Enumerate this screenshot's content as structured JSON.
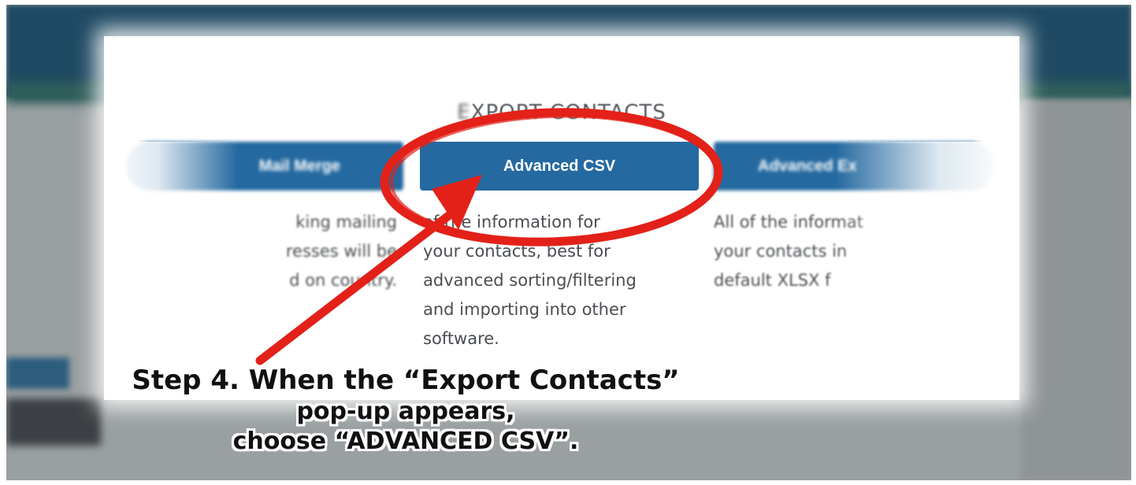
{
  "modal": {
    "title_prefix": "E",
    "title": "XPORT CONTACTS",
    "options": [
      {
        "label": "Mail Merge",
        "description": "king mailing\nresses will be\nd on country."
      },
      {
        "label": "Advanced CSV",
        "description": "of the information for\nyour contacts, best for\nadvanced sorting/filtering\nand importing into other\nsoftware."
      },
      {
        "label": "Advanced Ex",
        "description": "All of the informat\nyour contacts in\ndefault XLSX f"
      }
    ]
  },
  "annotation": {
    "caption_line1": "Step 4. When the “Export Contacts”",
    "caption_line2": "pop-up appears,",
    "caption_line3": "choose “ADVANCED CSV”.",
    "highlight_color": "#e32119",
    "highlighted_option": "Advanced CSV"
  },
  "colors": {
    "button_blue": "#2469a0",
    "header_navy": "#1f4a63"
  }
}
